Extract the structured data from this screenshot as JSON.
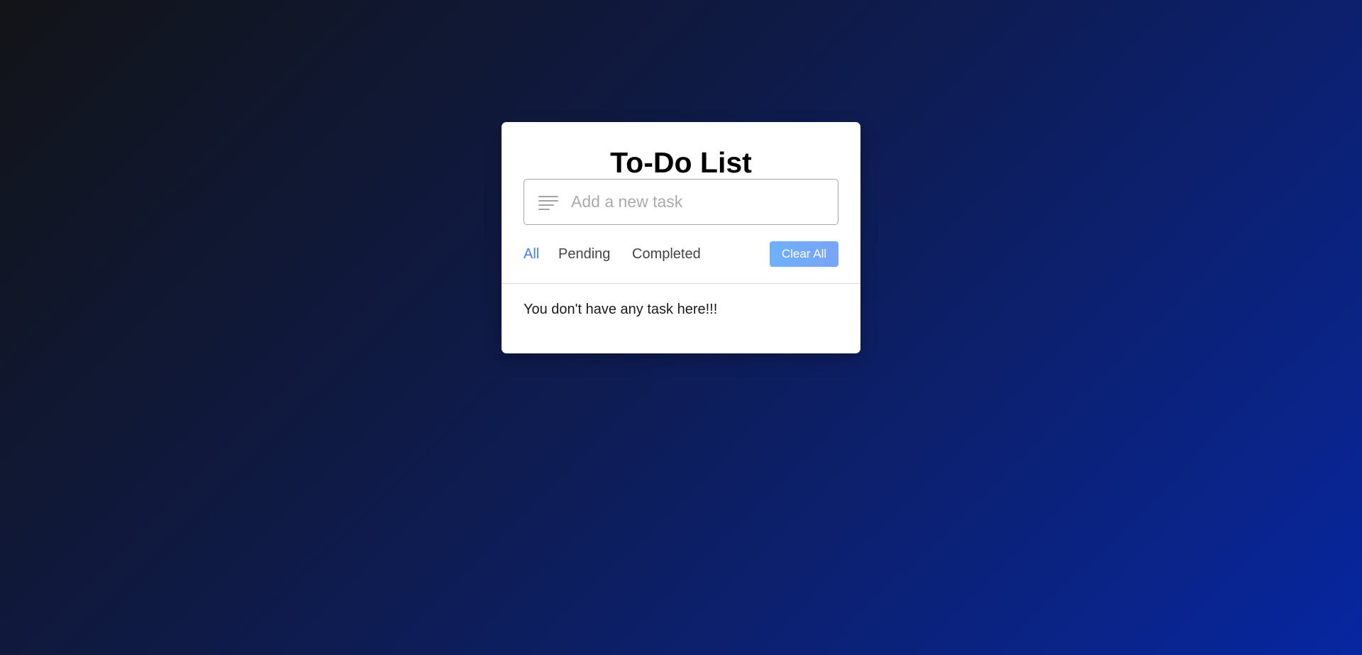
{
  "app": {
    "title": "To-Do List"
  },
  "task_input": {
    "placeholder": "Add a new task",
    "value": "",
    "icon": "text-lines-icon"
  },
  "filters": {
    "all": "All",
    "pending": "Pending",
    "completed": "Completed",
    "active": "All"
  },
  "clear_button": {
    "label": "Clear All"
  },
  "task_list": {
    "empty_message": "You don't have any task here!!!"
  },
  "colors": {
    "accent": "#3f7fe8",
    "button": "#74a9f8",
    "card": "#ffffff",
    "background_start": "#121417",
    "background_end": "#0726a1"
  }
}
